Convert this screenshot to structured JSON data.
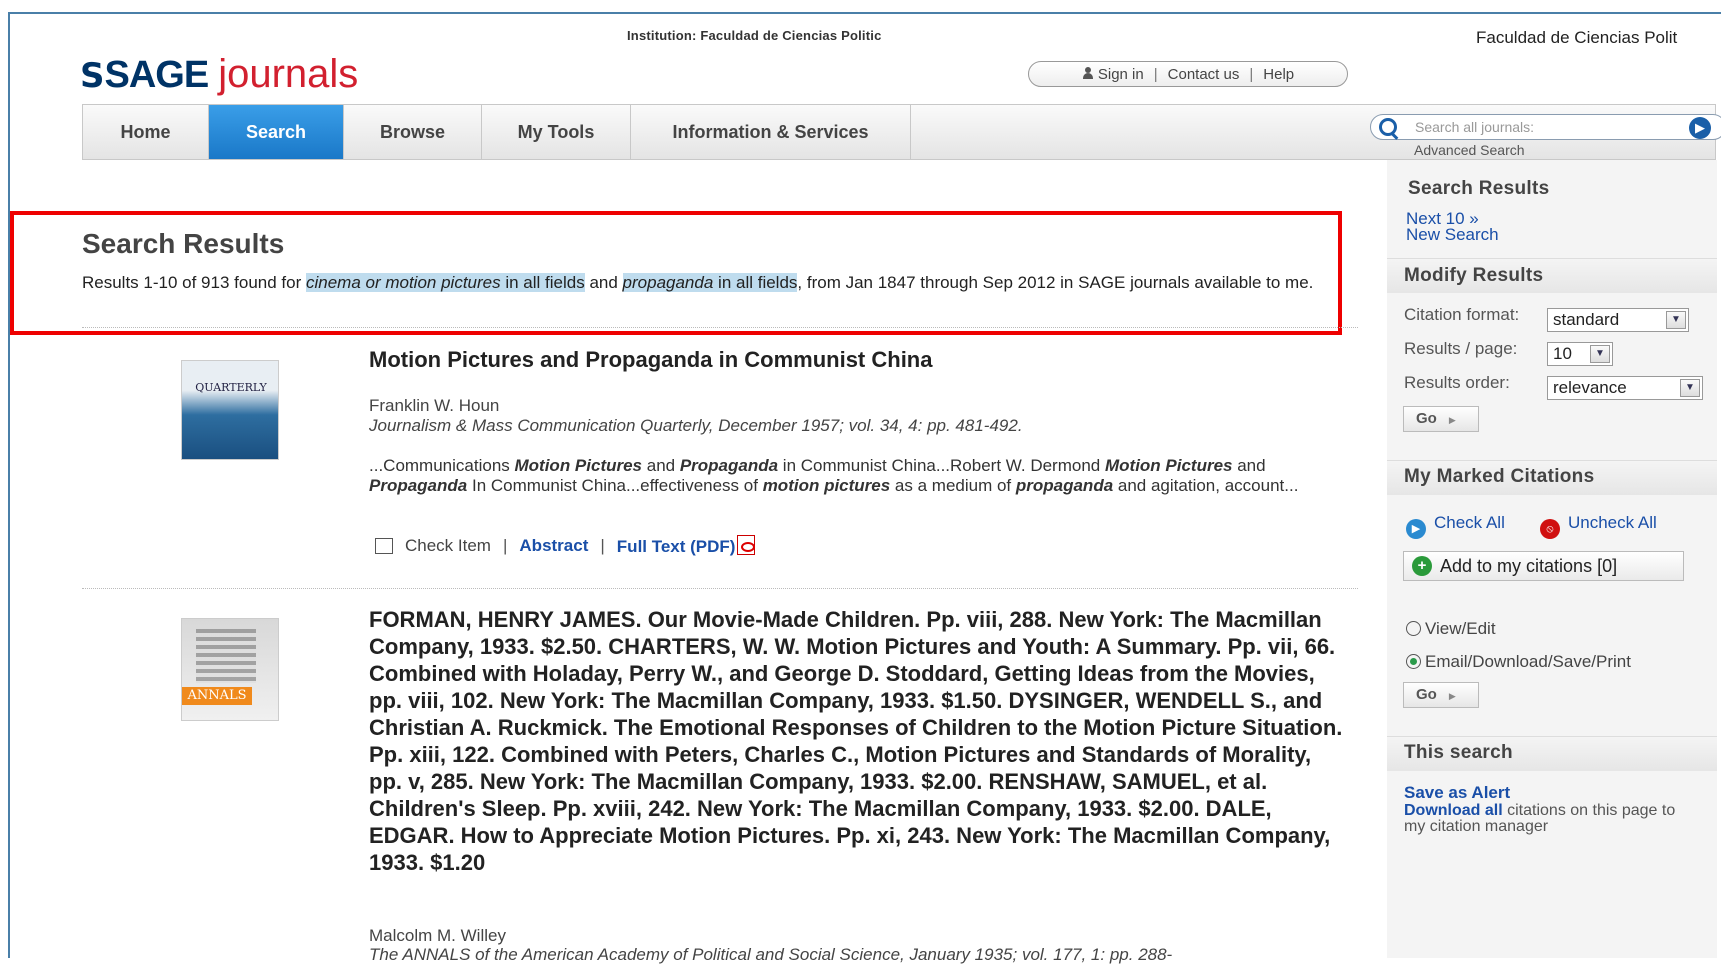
{
  "header": {
    "institution": "Institution: Faculdad de Ciencias Politic",
    "institution_right": "Faculdad de Ciencias Polit",
    "logo_symbol": "S",
    "logo_sage": "SAGE",
    "logo_journals": "journals",
    "sign_in": "Sign in",
    "contact_us": "Contact us",
    "help": "Help",
    "search_placeholder": "Search all journals:",
    "advanced_search": "Advanced Search"
  },
  "nav": {
    "tabs": [
      "Home",
      "Search",
      "Browse",
      "My Tools",
      "Information & Services"
    ],
    "active": "Search"
  },
  "results_header": {
    "title": "Search Results",
    "prefix": "Results 1-10 of 913 found for ",
    "term1": "cinema or motion pictures",
    "scope1": " in all fields",
    "and": " and ",
    "term2": "propaganda",
    "scope2": " in all fields",
    "suffix": ", from Jan 1847 through Sep 2012 in SAGE journals available to me."
  },
  "results": [
    {
      "title": "Motion Pictures and Propaganda in Communist China",
      "author": "Franklin W. Houn",
      "journal": "Journalism & Mass Communication Quarterly, December 1957; vol. 34, 4: pp. 481-492.",
      "snippet_parts": [
        {
          "t": "...Communications ",
          "b": false
        },
        {
          "t": "Motion Pictures",
          "b": true
        },
        {
          "t": " and ",
          "b": false
        },
        {
          "t": "Propaganda",
          "b": true
        },
        {
          "t": " in Communist China...Robert W. Dermond ",
          "b": false
        },
        {
          "t": "Motion Pictures",
          "b": true
        },
        {
          "t": " and ",
          "b": false
        },
        {
          "t": "Propaganda",
          "b": true
        },
        {
          "t": " In Communist China...effectiveness of ",
          "b": false
        },
        {
          "t": "motion pictures",
          "b": true
        },
        {
          "t": " as a medium of ",
          "b": false
        },
        {
          "t": "propaganda",
          "b": true
        },
        {
          "t": " and agitation, account...",
          "b": false
        }
      ],
      "check_label": "Check Item",
      "abstract_label": "Abstract",
      "fulltext_label": "Full Text (PDF)",
      "cover_text": "QUARTERLY"
    },
    {
      "title": "FORMAN, HENRY JAMES. Our Movie-Made Children. Pp. viii, 288. New York: The Macmillan Company, 1933. $2.50. CHARTERS, W. W. Motion Pictures and Youth: A Summary. Pp. vii, 66. Combined with Holaday, Perry W., and George D. Stoddard, Getting Ideas from the Movies, pp. viii, 102. New York: The Macmillan Company, 1933. $1.50. DYSINGER, WENDELL S., and Christian A. Ruckmick. The Emotional Responses of Children to the Motion Picture Situation. Pp. xiii, 122. Combined with Peters, Charles C., Motion Pictures and Standards of Morality, pp. v, 285. New York: The Macmillan Company, 1933. $2.00. RENSHAW, SAMUEL, et al. Children's Sleep. Pp. xviii, 242. New York: The Macmillan Company, 1933. $2.00. DALE, EDGAR. How to Appreciate Motion Pictures. Pp. xi, 243. New York: The Macmillan Company, 1933. $1.20",
      "author": "Malcolm M. Willey",
      "journal": "The ANNALS of the American Academy of Political and Social Science, January 1935; vol. 177, 1: pp. 288-",
      "cover_text": "ANNALS"
    }
  ],
  "sidebar": {
    "search_results_title": "Search Results",
    "next": "Next 10 »",
    "new_search": "New Search",
    "modify_title": "Modify Results",
    "citation_format_label": "Citation format:",
    "citation_format_value": "standard",
    "results_per_page_label": "Results / page:",
    "results_per_page_value": "10",
    "results_order_label": "Results order:",
    "results_order_value": "relevance",
    "go": "Go",
    "marked_title": "My Marked Citations",
    "check_all": "Check All",
    "uncheck_all": "Uncheck All",
    "add_citations": "Add to my citations [0]",
    "view_edit": "View/Edit",
    "email_download": "Email/Download/Save/Print",
    "this_search_title": "This search",
    "save_alert": "Save as Alert",
    "download_all": "Download all",
    "download_rest": " citations on this page to my citation manager"
  },
  "colors": {
    "brand_blue": "#003366",
    "brand_red": "#d2202f",
    "active_tab": "#1a78c8",
    "link": "#1a4fa8",
    "highlight_border": "#e00000",
    "term_highlight": "#bfdcee"
  }
}
